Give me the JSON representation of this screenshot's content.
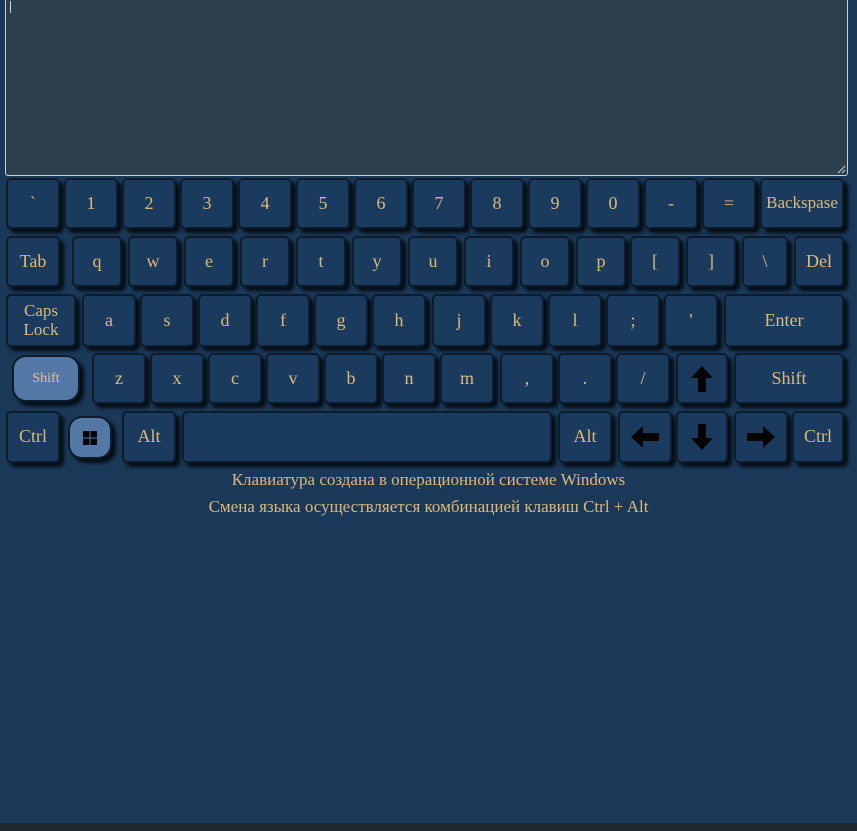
{
  "textarea": {
    "value": ""
  },
  "keyboard": {
    "row1": [
      "`",
      "1",
      "2",
      "3",
      "4",
      "5",
      "6",
      "7",
      "8",
      "9",
      "0",
      "-",
      "=",
      "Backspase"
    ],
    "row2": [
      "Tab",
      "q",
      "w",
      "e",
      "r",
      "t",
      "y",
      "u",
      "i",
      "o",
      "p",
      "[",
      "]",
      "\\",
      "Del"
    ],
    "row3": [
      "Caps Lock",
      "a",
      "s",
      "d",
      "f",
      "g",
      "h",
      "j",
      "k",
      "l",
      ";",
      "'",
      "Enter"
    ],
    "row4": [
      "Shift",
      "z",
      "x",
      "c",
      "v",
      "b",
      "n",
      "m",
      ",",
      ".",
      "/",
      "↑",
      "Shift"
    ],
    "row5": [
      "Ctrl",
      "Win",
      "Alt",
      "",
      "Alt",
      "←",
      "↓",
      "→",
      "Ctrl"
    ],
    "active_keys": [
      "Shift"
    ]
  },
  "icons": {
    "win": "windows-logo-icon",
    "up": "arrow-up-icon",
    "left": "arrow-left-icon",
    "down": "arrow-down-icon",
    "right": "arrow-right-icon"
  },
  "colors": {
    "background": "#1a3858",
    "key": "#1b3b5e",
    "key_text": "#dcb97a",
    "key_active": "#5478a6",
    "textarea": "#2d3e4d"
  },
  "info": {
    "line1": "Клавиатура создана в операционной системе Windows",
    "line2": "Смена языка осуществляется комбинацией клавиш Ctrl + Alt"
  }
}
